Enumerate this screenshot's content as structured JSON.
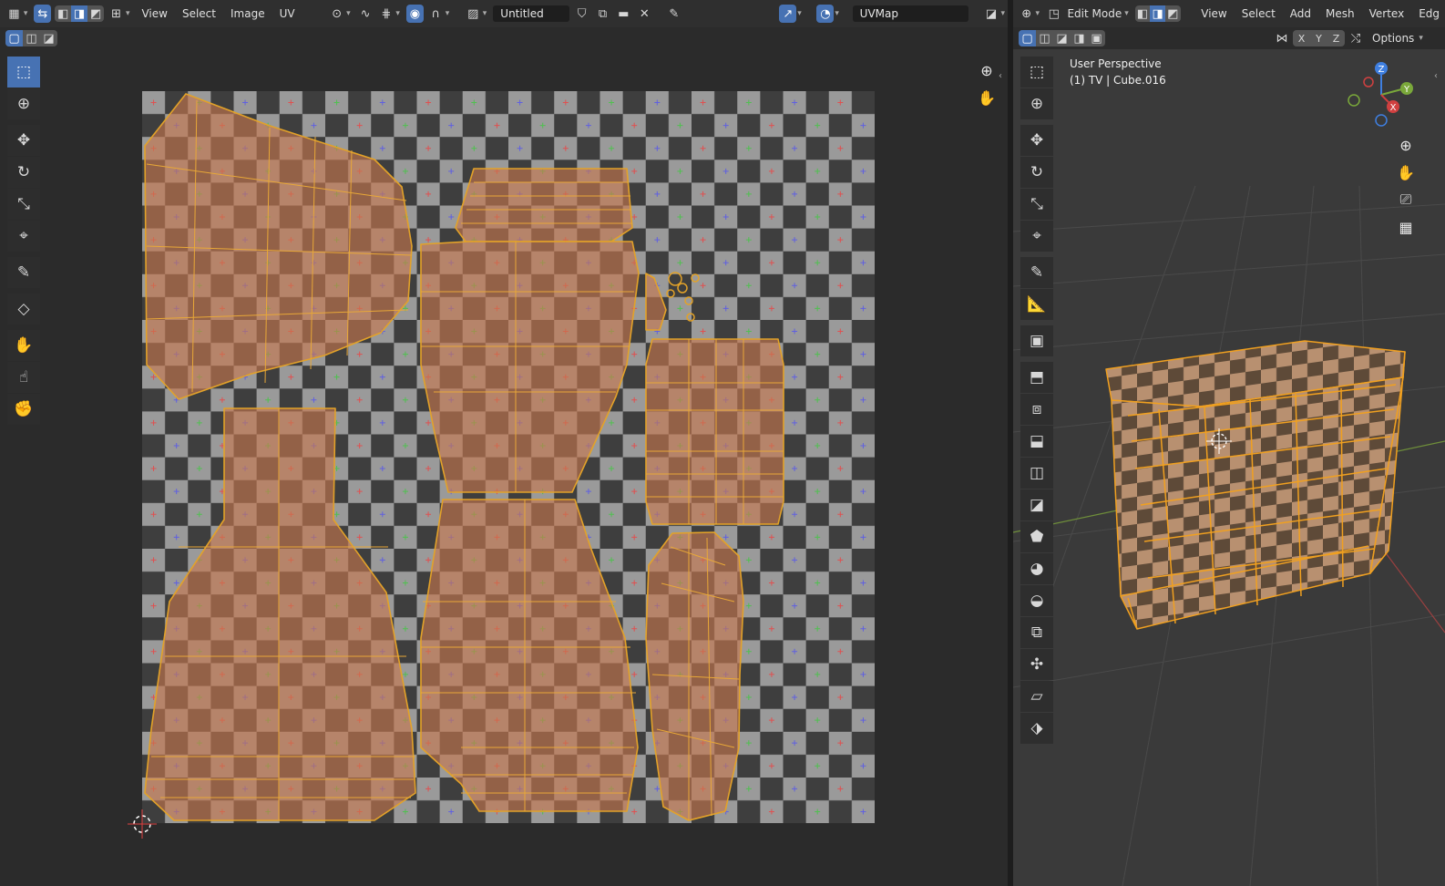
{
  "uv_editor": {
    "menus": [
      "View",
      "Select",
      "Image",
      "UV"
    ],
    "image_name": "Untitled",
    "uv_map_name": "UVMap"
  },
  "viewport": {
    "mode": "Edit Mode",
    "menus": [
      "View",
      "Select",
      "Add",
      "Mesh",
      "Vertex",
      "Edg"
    ],
    "axes": [
      "X",
      "Y",
      "Z"
    ],
    "options_label": "Options",
    "perspective_label": "User Perspective",
    "object_label": "(1) TV | Cube.016",
    "gizmo": {
      "z": "Z",
      "y": "Y",
      "x": "X"
    }
  },
  "colors": {
    "accent": "#4772b3",
    "header_bg": "#2f2f2f",
    "pane_bg": "#2b2b2b",
    "uv_face_fill": "#c8784e",
    "uv_edge": "#e0a020",
    "checker_light": "#9a9a9a",
    "checker_dark": "#3e3e3e"
  }
}
